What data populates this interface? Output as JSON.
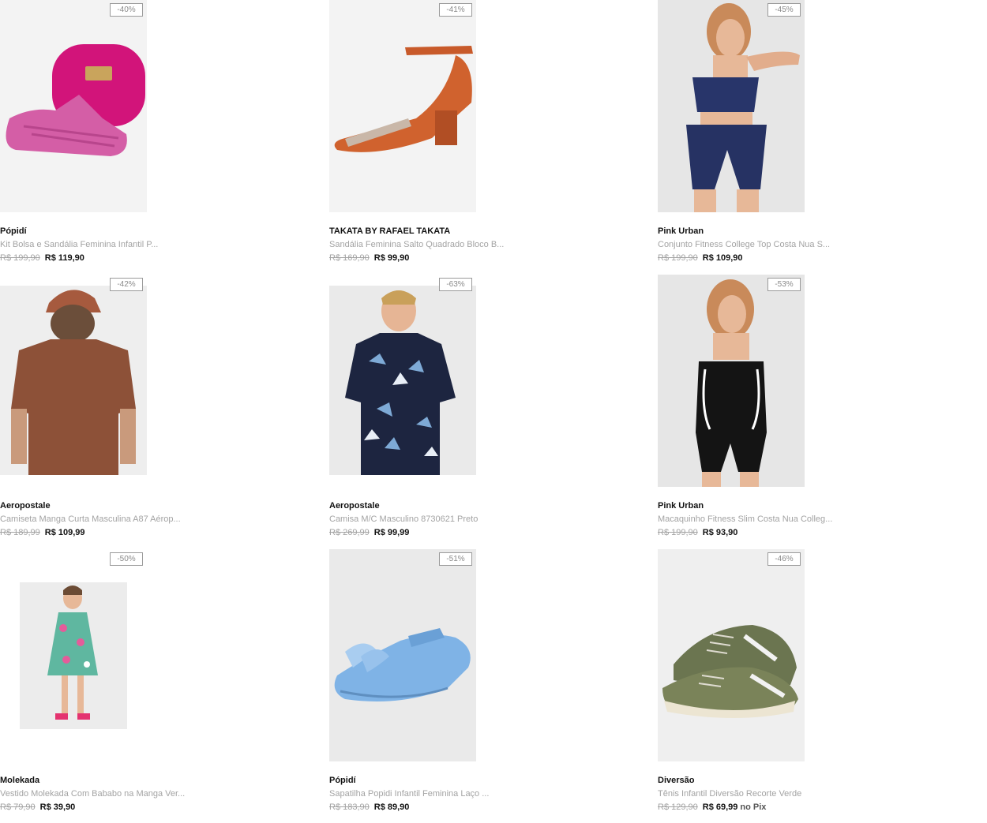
{
  "products": [
    {
      "badge": "-40%",
      "brand": "Pópidí",
      "title": "Kit Bolsa e Sandália Feminina Infantil P...",
      "old_price": "R$ 199,90",
      "price": "R$ 119,90"
    },
    {
      "badge": "-41%",
      "brand": "TAKATA BY RAFAEL TAKATA",
      "title": "Sandália Feminina Salto Quadrado Bloco B...",
      "old_price": "R$ 169,90",
      "price": "R$ 99,90"
    },
    {
      "badge": "-45%",
      "brand": "Pink Urban",
      "title": "Conjunto Fitness College Top Costa Nua S...",
      "old_price": "R$ 199,90",
      "price": "R$ 109,90"
    },
    {
      "badge": "-42%",
      "brand": "Aeropostale",
      "title": "Camiseta Manga Curta Masculina A87 Aérop...",
      "old_price": "R$ 189,99",
      "price": "R$ 109,99"
    },
    {
      "badge": "-63%",
      "brand": "Aeropostale",
      "title": "Camisa M/C Masculino 8730621 Preto",
      "old_price": "R$ 269,99",
      "price": "R$ 99,99"
    },
    {
      "badge": "-53%",
      "brand": "Pink Urban",
      "title": "Macaquinho Fitness Slim Costa Nua Colleg...",
      "old_price": "R$ 199,90",
      "price": "R$ 93,90"
    },
    {
      "badge": "-50%",
      "brand": "Molekada",
      "title": "Vestido Molekada Com Bababo na Manga Ver...",
      "old_price": "R$ 79,90",
      "price": "R$ 39,90"
    },
    {
      "badge": "-51%",
      "brand": "Pópidí",
      "title": "Sapatilha Popidi Infantil Feminina Laço ...",
      "old_price": "R$ 183,90",
      "price": "R$ 89,90"
    },
    {
      "badge": "-46%",
      "brand": "Diversão",
      "title": "Tênis Infantil Diversão Recorte Verde",
      "old_price": "R$ 129,90",
      "price": "R$ 69,99",
      "price_suffix": "no Pix"
    }
  ]
}
